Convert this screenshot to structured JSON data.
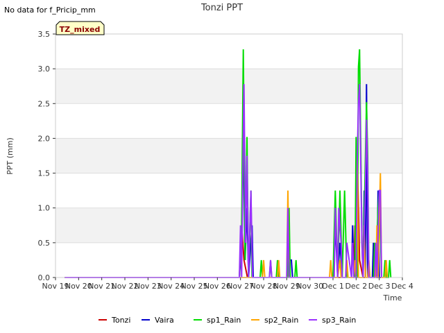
{
  "note": "No data for f_Pricip_mm",
  "badge": "TZ_mixed",
  "chart_data": {
    "type": "line",
    "title": "Tonzi PPT",
    "xlabel": "Time",
    "ylabel": "PPT (mm)",
    "ylim": [
      0,
      3.5
    ],
    "xlim": [
      0,
      15
    ],
    "x_ticks": [
      "Nov 19",
      "Nov 20",
      "Nov 21",
      "Nov 22",
      "Nov 23",
      "Nov 24",
      "Nov 25",
      "Nov 26",
      "Nov 27",
      "Nov 28",
      "Nov 29",
      "Nov 30",
      "Dec 1",
      "Dec 2",
      "Dec 3",
      "Dec 4"
    ],
    "y_ticks": [
      0.0,
      0.5,
      1.0,
      1.5,
      2.0,
      2.5,
      3.0,
      3.5
    ],
    "y_tick_labels": [
      "0.0",
      "0.5",
      "1.0",
      "1.5",
      "2.0",
      "2.5",
      "3.0",
      "3.5"
    ],
    "grid": true,
    "legend_position": "bottom",
    "x_unit": "days since Nov 19",
    "series": [
      {
        "name": "Tonzi",
        "color": "#cc0000",
        "points": [
          [
            0.4,
            0
          ],
          [
            7.95,
            0
          ],
          [
            8.05,
            0.75
          ],
          [
            8.15,
            0.25
          ],
          [
            8.3,
            0
          ],
          [
            12.9,
            0
          ],
          [
            12.95,
            0.75
          ],
          [
            13.0,
            0
          ],
          [
            13.05,
            1.75
          ],
          [
            13.15,
            0.25
          ],
          [
            13.3,
            0
          ],
          [
            14.0,
            0
          ]
        ]
      },
      {
        "name": "Vaira",
        "color": "#0000cc",
        "points": [
          [
            0.4,
            0
          ],
          [
            7.95,
            0
          ],
          [
            8.05,
            0.5
          ],
          [
            8.12,
            2.02
          ],
          [
            8.2,
            0.25
          ],
          [
            8.28,
            1.0
          ],
          [
            8.35,
            0
          ],
          [
            8.5,
            0.75
          ],
          [
            8.55,
            0
          ],
          [
            10.05,
            0
          ],
          [
            10.1,
            0.25
          ],
          [
            10.2,
            0.25
          ],
          [
            10.25,
            0
          ],
          [
            12.0,
            0
          ],
          [
            12.1,
            0.75
          ],
          [
            12.2,
            0
          ],
          [
            12.3,
            0.5
          ],
          [
            12.4,
            0
          ],
          [
            12.8,
            0
          ],
          [
            12.85,
            0.75
          ],
          [
            12.9,
            0
          ],
          [
            13.3,
            0
          ],
          [
            13.35,
            1.25
          ],
          [
            13.4,
            0
          ],
          [
            13.45,
            2.78
          ],
          [
            13.5,
            0
          ],
          [
            13.7,
            0
          ],
          [
            13.75,
            0.5
          ],
          [
            13.8,
            0
          ],
          [
            13.9,
            0
          ],
          [
            13.95,
            1.25
          ],
          [
            14.0,
            0
          ],
          [
            14.1,
            0
          ]
        ]
      },
      {
        "name": "sp1_Rain",
        "color": "#00dd00",
        "points": [
          [
            0.4,
            0
          ],
          [
            7.95,
            0
          ],
          [
            8.05,
            0.75
          ],
          [
            8.12,
            3.28
          ],
          [
            8.2,
            0.25
          ],
          [
            8.28,
            2.02
          ],
          [
            8.35,
            0
          ],
          [
            8.45,
            1.25
          ],
          [
            8.5,
            0
          ],
          [
            8.85,
            0
          ],
          [
            8.9,
            0.25
          ],
          [
            8.95,
            0
          ],
          [
            9.25,
            0
          ],
          [
            9.3,
            0.25
          ],
          [
            9.35,
            0
          ],
          [
            9.55,
            0
          ],
          [
            9.6,
            0.25
          ],
          [
            9.65,
            0
          ],
          [
            10.05,
            0
          ],
          [
            10.1,
            1.0
          ],
          [
            10.15,
            0
          ],
          [
            10.35,
            0
          ],
          [
            10.4,
            0.25
          ],
          [
            10.45,
            0
          ],
          [
            12.0,
            0
          ],
          [
            12.1,
            1.25
          ],
          [
            12.2,
            0
          ],
          [
            12.3,
            1.25
          ],
          [
            12.4,
            0
          ],
          [
            12.5,
            1.25
          ],
          [
            12.6,
            0
          ],
          [
            12.95,
            0
          ],
          [
            13.0,
            2.02
          ],
          [
            13.05,
            0
          ],
          [
            13.1,
            3.03
          ],
          [
            13.15,
            3.28
          ],
          [
            13.25,
            0.5
          ],
          [
            13.3,
            0
          ],
          [
            13.45,
            2.52
          ],
          [
            13.5,
            1.75
          ],
          [
            13.55,
            0
          ],
          [
            13.75,
            0
          ],
          [
            13.8,
            0.5
          ],
          [
            13.85,
            0
          ],
          [
            13.95,
            1.0
          ],
          [
            14.0,
            1.25
          ],
          [
            14.1,
            0
          ],
          [
            14.2,
            0
          ],
          [
            14.25,
            0.25
          ],
          [
            14.3,
            0
          ],
          [
            14.4,
            0
          ],
          [
            14.45,
            0.25
          ],
          [
            14.5,
            0
          ]
        ]
      },
      {
        "name": "sp2_Rain",
        "color": "#ffa500",
        "points": [
          [
            0.4,
            0
          ],
          [
            8.95,
            0
          ],
          [
            9.0,
            0.25
          ],
          [
            9.05,
            0
          ],
          [
            9.6,
            0
          ],
          [
            9.65,
            0.25
          ],
          [
            9.7,
            0
          ],
          [
            10.0,
            0
          ],
          [
            10.05,
            1.25
          ],
          [
            10.1,
            0
          ],
          [
            11.85,
            0
          ],
          [
            11.9,
            0.25
          ],
          [
            11.95,
            0
          ],
          [
            12.2,
            0
          ],
          [
            12.3,
            0.25
          ],
          [
            12.35,
            0
          ],
          [
            12.55,
            0
          ],
          [
            12.6,
            0.25
          ],
          [
            12.65,
            0
          ],
          [
            12.9,
            0
          ],
          [
            12.95,
            0.25
          ],
          [
            13.0,
            0
          ],
          [
            13.05,
            1.75
          ],
          [
            13.1,
            0
          ],
          [
            13.3,
            0
          ],
          [
            13.35,
            0.75
          ],
          [
            13.4,
            0
          ],
          [
            13.5,
            0
          ],
          [
            13.55,
            0.25
          ],
          [
            13.6,
            0
          ],
          [
            13.85,
            0
          ],
          [
            13.9,
            0.75
          ],
          [
            13.95,
            0
          ],
          [
            14.05,
            1.5
          ],
          [
            14.1,
            0
          ],
          [
            14.25,
            0
          ],
          [
            14.3,
            0.25
          ],
          [
            14.35,
            0
          ]
        ]
      },
      {
        "name": "sp3_Rain",
        "color": "#9b30ff",
        "points": [
          [
            0.4,
            0
          ],
          [
            7.95,
            0
          ],
          [
            8.0,
            0.75
          ],
          [
            8.05,
            0
          ],
          [
            8.1,
            1.5
          ],
          [
            8.15,
            2.78
          ],
          [
            8.22,
            0.5
          ],
          [
            8.28,
            1.75
          ],
          [
            8.35,
            0
          ],
          [
            8.45,
            1.25
          ],
          [
            8.52,
            0
          ],
          [
            9.25,
            0
          ],
          [
            9.3,
            0.25
          ],
          [
            9.35,
            0
          ],
          [
            10.0,
            0
          ],
          [
            10.05,
            1.0
          ],
          [
            10.1,
            0
          ],
          [
            12.05,
            0
          ],
          [
            12.1,
            1.0
          ],
          [
            12.2,
            0
          ],
          [
            12.25,
            1.0
          ],
          [
            12.35,
            0.5
          ],
          [
            12.4,
            0
          ],
          [
            12.55,
            0
          ],
          [
            12.6,
            0.5
          ],
          [
            12.7,
            0.25
          ],
          [
            12.8,
            0
          ],
          [
            12.85,
            0.5
          ],
          [
            12.9,
            0
          ],
          [
            13.0,
            0
          ],
          [
            13.05,
            1.75
          ],
          [
            13.1,
            2.52
          ],
          [
            13.15,
            2.78
          ],
          [
            13.25,
            0.5
          ],
          [
            13.3,
            0
          ],
          [
            13.4,
            1.25
          ],
          [
            13.45,
            2.27
          ],
          [
            13.5,
            1.5
          ],
          [
            13.55,
            0
          ],
          [
            13.8,
            0
          ],
          [
            13.85,
            0.5
          ],
          [
            13.9,
            0
          ],
          [
            14.0,
            1.25
          ],
          [
            14.05,
            1.25
          ],
          [
            14.1,
            0
          ]
        ]
      }
    ]
  }
}
